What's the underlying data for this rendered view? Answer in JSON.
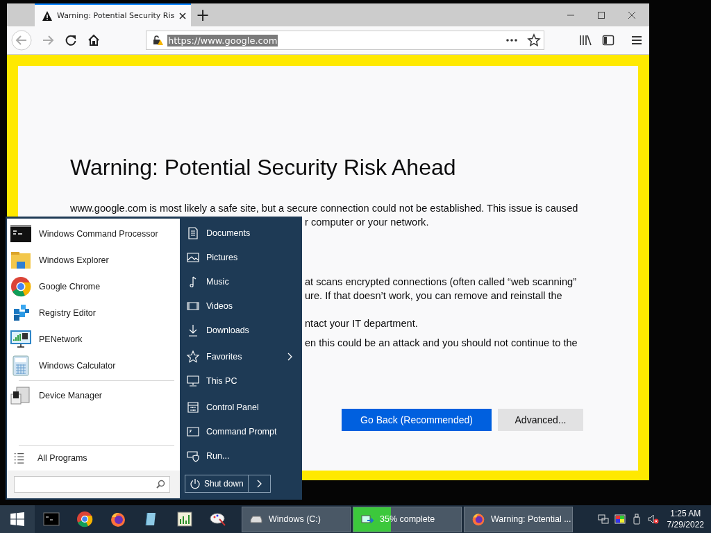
{
  "browser": {
    "tab": {
      "title": "Warning: Potential Security Ris",
      "selected": true
    },
    "new_tab": "+",
    "url": "https://www.google.com",
    "url_selected": true
  },
  "page": {
    "heading": "Warning: Potential Security Risk Ahead",
    "paragraphs": [
      [
        "www.google.com is most likely a safe site, but a secure connection could not be established. This issue is caused",
        "r computer or your network."
      ],
      [
        "at scans encrypted connections (often called “web scanning”",
        "ure. If that doesn’t work, you can remove and reinstall the"
      ],
      [
        "ntact your IT department."
      ],
      [
        "en this could be an attack and you should not continue to the"
      ]
    ],
    "buttons": [
      {
        "label": "Go Back (Recommended)",
        "kind": "primary"
      },
      {
        "label": "Advanced...",
        "kind": "secondary"
      }
    ]
  },
  "start_menu": {
    "programs": [
      {
        "label": "Windows Command Processor"
      },
      {
        "label": "Windows Explorer"
      },
      {
        "label": "Google Chrome"
      },
      {
        "label": "Registry Editor"
      },
      {
        "label": "PENetwork"
      },
      {
        "label": "Windows Calculator"
      }
    ],
    "recent": [
      {
        "label": "Device Manager"
      }
    ],
    "all_programs": "All Programs",
    "places": [
      {
        "label": "Documents",
        "submenu": false
      },
      {
        "label": "Pictures",
        "submenu": false
      },
      {
        "label": "Music",
        "submenu": false
      },
      {
        "label": "Videos",
        "submenu": false
      },
      {
        "label": "Downloads",
        "submenu": false
      },
      {
        "label": "Favorites",
        "submenu": true
      },
      {
        "label": "This PC",
        "submenu": false
      },
      {
        "label": "Control Panel",
        "submenu": false
      },
      {
        "label": "Command Prompt",
        "submenu": false
      },
      {
        "label": "Run...",
        "submenu": false
      }
    ],
    "shutdown": "Shut down"
  },
  "taskbar": {
    "tasks": [
      {
        "label": "Windows (C:)",
        "kind": "drive"
      },
      {
        "label": "35% complete",
        "kind": "progress",
        "level": 0.35
      },
      {
        "label": "Warning: Potential ...",
        "kind": "browser"
      }
    ],
    "clock": {
      "time": "1:25 AM",
      "date": "7/29/2022"
    }
  }
}
